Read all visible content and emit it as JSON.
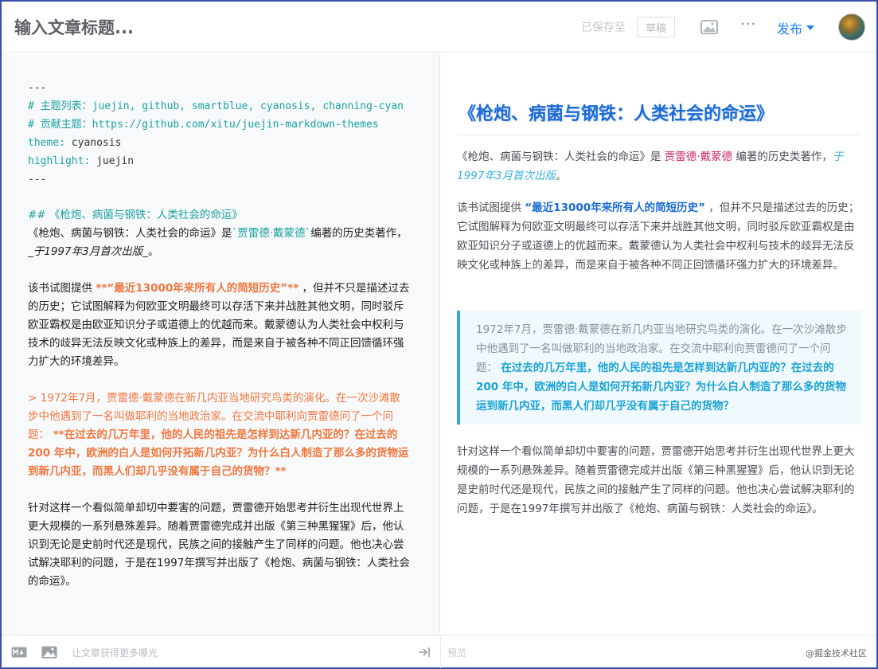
{
  "header": {
    "title_placeholder": "输入文章标题...",
    "saved_text": "已保存至",
    "draft_label": "草稿",
    "more_label": "···",
    "publish_label": "发布"
  },
  "editor": {
    "fm_open": "---",
    "fm_theme_list": "# 主题列表：juejin, github, smartblue, cyanosis, channing-cyan",
    "fm_contrib": "# 贡献主题：https://github.com/xitu/juejin-markdown-themes",
    "fm_theme_key": "theme:",
    "fm_theme_val": " cyanosis",
    "fm_hl_key": "highlight:",
    "fm_hl_val": " juejin",
    "fm_close": "---",
    "heading": "## 《枪炮、病菌与钢铁：人类社会的命运》",
    "p1_a": "《枪炮、病菌与钢铁：人类社会的命运》是",
    "p1_author": "`贾雷德·戴蒙德`",
    "p1_b": "编著的历史类著作，",
    "p1_italic": "_于1997年3月首次出版_",
    "p1_c": "。",
    "p2_a": "该书试图提供 ",
    "p2_bold": "**“最近13000年来所有人的简短历史”**",
    "p2_b": " ，但并不只是描述过去的历史；它试图解释为何欧亚文明最终可以存活下来并战胜其他文明，同时驳斥欧亚霸权是由欧亚知识分子或道德上的优越而来。戴蒙德认为人类社会中权利与技术的歧异无法反映文化或种族上的差异，而是来自于被各种不同正回馈循环强力扩大的环境差异。",
    "quote_a": "> 1972年7月，贾雷德·戴蒙德在新几内亚当地研究鸟类的演化。在一次沙滩散步中他遇到了一名叫做耶利的当地政治家。在交流中耶利向贾雷德问了一个问题：",
    "quote_bold": " **在过去的几万年里，他的人民的祖先是怎样到达新几内亚的？在过去的 200 年中，欧洲的白人是如何开拓新几内亚？为什么白人制造了那么多的货物运到新几内亚，而黑人们却几乎没有属于自己的货物？**",
    "p3": "针对这样一个看似简单却切中要害的问题，贾雷德开始思考并衍生出现代世界上更大规模的一系列悬殊差异。随着贾雷德完成并出版《第三种黑猩猩》后，他认识到无论是史前时代还是现代，民族之间的接触产生了同样的问题。他也决心尝试解决耶利的问题，于是在1997年撰写并出版了《枪炮、病菌与钢铁：人类社会的命运》。"
  },
  "preview": {
    "heading": "《枪炮、病菌与钢铁：人类社会的命运》",
    "p1_a": "《枪炮、病菌与钢铁：人类社会的命运》是 ",
    "p1_author": "贾雷德·戴蒙德",
    "p1_b": " 编著的历史类著作，",
    "p1_italic": "于1997年3月首次出版",
    "p1_c": "。",
    "p2_a": "该书试图提供 ",
    "p2_bold": "“最近13000年来所有人的简短历史”",
    "p2_b": " ，但并不只是描述过去的历史；它试图解释为何欧亚文明最终可以存活下来并战胜其他文明，同时驳斥欧亚霸权是由欧亚知识分子或道德上的优越而来。戴蒙德认为人类社会中权利与技术的歧异无法反映文化或种族上的差异，而是来自于被各种不同正回馈循环强力扩大的环境差异。",
    "quote_a": "1972年7月，贾雷德·戴蒙德在新几内亚当地研究鸟类的演化。在一次沙滩散步中他遇到了一名叫做耶利的当地政治家。在交流中耶利向贾雷德问了一个问题： ",
    "quote_bold": "在过去的几万年里，他的人民的祖先是怎样到达新几内亚的？在过去的 200 年中，欧洲的白人是如何开拓新几内亚？为什么白人制造了那么多的货物运到新几内亚，而黑人们却几乎没有属于自己的货物？",
    "p3": "针对这样一个看似简单却切中要害的问题，贾雷德开始思考并衍生出现代世界上更大规模的一系列悬殊差异。随着贾雷德完成并出版《第三种黑猩猩》后，他认识到无论是史前时代还是现代，民族之间的接触产生了同样的问题。他也决心尝试解决耶利的问题，于是在1997年撰写并出版了《枪炮、病菌与钢铁：人类社会的命运》。"
  },
  "footer": {
    "hint": "让文章获得更多曝光",
    "preview_label": "预览",
    "watermark": "@掘金技术社区"
  },
  "colors": {
    "accent": "#1e80ff",
    "heading_blue": "#1a6bd6",
    "code_teal": "#1ba2a2",
    "md_orange": "#f0773f",
    "author_pink": "#d0286a"
  }
}
